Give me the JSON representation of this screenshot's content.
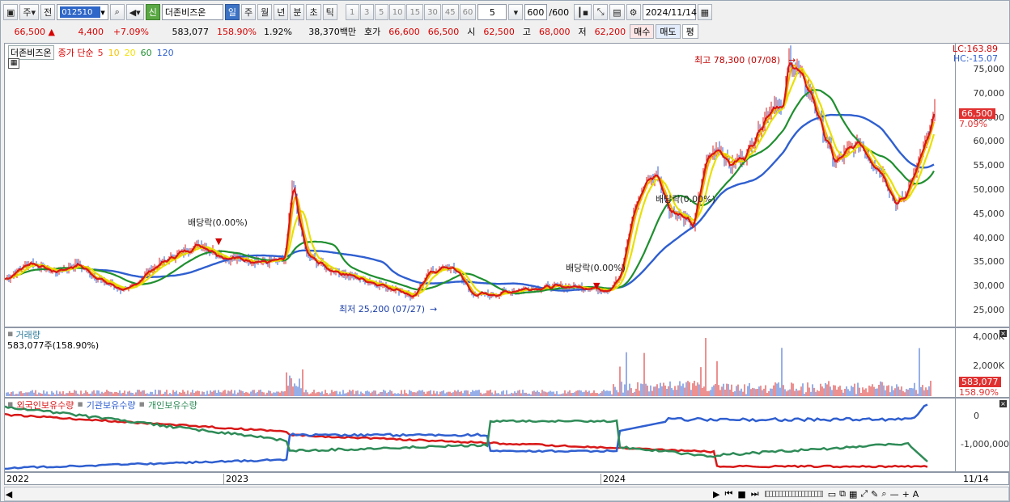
{
  "toolbar": {
    "type_btn": "주",
    "prev_btn": "전",
    "code": "012510",
    "sin_btn": "신",
    "stock_name": "더존비즈온",
    "period_tabs": [
      "일",
      "주",
      "월",
      "년",
      "분",
      "초",
      "틱"
    ],
    "selected_period": "일",
    "interval_btns": [
      "1",
      "3",
      "5",
      "10",
      "15",
      "30",
      "45",
      "60"
    ],
    "interval_value": "5",
    "count": "600",
    "count_total": "/600",
    "date": "2024/11/14"
  },
  "quote": {
    "price": "66,500",
    "change": "4,400",
    "change_pct": "+7.09%",
    "volume": "583,077",
    "volume_ratio": "158.90%",
    "turnover": "1.92%",
    "amount": "38,370백만",
    "ask_label": "호가",
    "ask": "66,600",
    "bid": "66,500",
    "open_label": "시",
    "open": "62,500",
    "high_label": "고",
    "high": "68,000",
    "low_label": "저",
    "low": "62,200",
    "buy_btn": "매수",
    "sell_btn": "매도",
    "pyeong_btn": "평"
  },
  "price_panel": {
    "name": "더존비즈온",
    "ma_label": "종가 단순",
    "ma_periods": [
      "5",
      "10",
      "20",
      "60",
      "120"
    ],
    "ma_colors": [
      "#e02020",
      "#f5c400",
      "#f5e100",
      "#1f8f2f",
      "#2f5fd0"
    ],
    "lc": "LC:163.89",
    "hc": "HC:-15.07",
    "current_price": "66,500",
    "current_pct": "7.09%",
    "y_ticks": [
      "75,000",
      "70,000",
      "65,000",
      "60,000",
      "55,000",
      "50,000",
      "45,000",
      "40,000",
      "35,000",
      "30,000",
      "25,000"
    ],
    "annotations": {
      "high": "최고 78,300 (07/08)",
      "low": "최저 25,200 (07/27)",
      "div1": "배당락(0.00%)",
      "div2": "배당락(0.00%)",
      "div3": "배당락(0.00%)"
    }
  },
  "volume_panel": {
    "title": "거래량",
    "subtitle": "583,077주(158.90%)",
    "y_ticks": [
      "4,000K",
      "2,000K"
    ],
    "current": "583,077",
    "current_pct": "158.90%"
  },
  "holding_panel": {
    "legend": [
      "외국인보유수량",
      "기관보유수량",
      "개인보유수량"
    ],
    "colors": [
      "#d81818",
      "#2f5fd0",
      "#2e8b57"
    ],
    "y_ticks": [
      "0",
      "-1,000,000"
    ]
  },
  "x_axis": {
    "labels": [
      "2022",
      "2023",
      "2024"
    ],
    "end_label": "11/14"
  },
  "chart_data": {
    "type": "line",
    "x": [
      "2022",
      "2023",
      "2024",
      "11/14"
    ],
    "series": [
      {
        "name": "종가",
        "values": [
          32000,
          38500,
          29500,
          66500
        ]
      }
    ],
    "y_range": [
      23000,
      79000
    ],
    "ma_periods": [
      5,
      10,
      20,
      60,
      120
    ]
  }
}
